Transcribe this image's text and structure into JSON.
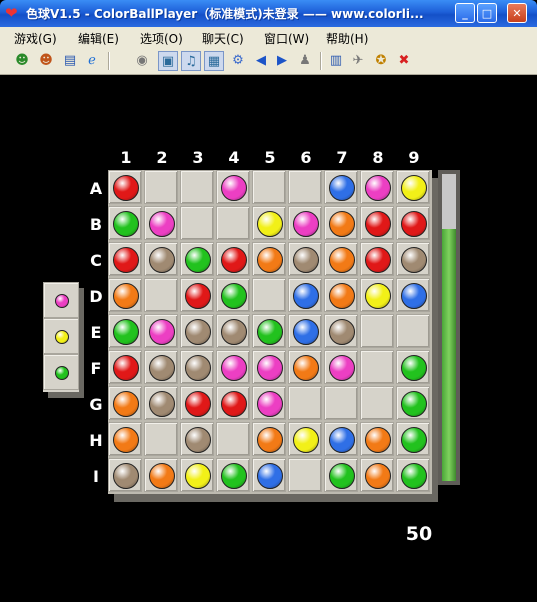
{
  "window": {
    "title": "色球V1.5 - ColorBallPlayer（标准模式)未登录 —— www.colorli...",
    "controls": [
      "_",
      "□",
      "✕"
    ]
  },
  "menu": [
    "游戏(G)",
    "编辑(E)",
    "选项(O)",
    "聊天(C)",
    "窗口(W)",
    "帮助(H)"
  ],
  "toolbar_icons": [
    "person-icon",
    "person-alt-icon",
    "window-icon",
    "ie-icon",
    "disc-icon",
    "fullscreen-icon",
    "sound-icon",
    "keyboard-icon",
    "gear-icon",
    "arrow-left-icon",
    "arrow-right-icon",
    "users-icon",
    "card-icon",
    "network-icon",
    "run-icon",
    "exit-icon"
  ],
  "board": {
    "columns": [
      "1",
      "2",
      "3",
      "4",
      "5",
      "6",
      "7",
      "8",
      "9"
    ],
    "rows": [
      "A",
      "B",
      "C",
      "D",
      "E",
      "F",
      "G",
      "H",
      "I"
    ],
    "cells": [
      [
        "red",
        "",
        "",
        "pink",
        "",
        "",
        "blue",
        "pink",
        "yellow"
      ],
      [
        "green",
        "pink",
        "",
        "",
        "yellow",
        "pink",
        "orange",
        "red",
        "red"
      ],
      [
        "red",
        "tan",
        "green",
        "red",
        "orange",
        "tan",
        "orange",
        "red",
        "tan"
      ],
      [
        "orange",
        "",
        "red",
        "green",
        "",
        "blue",
        "orange",
        "yellow",
        "blue"
      ],
      [
        "green",
        "pink",
        "tan",
        "tan",
        "green",
        "blue",
        "tan",
        "",
        ""
      ],
      [
        "red",
        "tan",
        "tan",
        "pink",
        "pink",
        "orange",
        "pink",
        "",
        "green"
      ],
      [
        "orange",
        "tan",
        "red",
        "red",
        "pink",
        "",
        "",
        "",
        "green"
      ],
      [
        "orange",
        "",
        "tan",
        "",
        "orange",
        "yellow",
        "blue",
        "orange",
        "green"
      ],
      [
        "tan",
        "orange",
        "yellow",
        "green",
        "blue",
        "",
        "green",
        "orange",
        "green"
      ]
    ]
  },
  "palette": {
    "red": "#e01818",
    "pink": "#ec3fc3",
    "blue": "#2f6fe6",
    "yellow": "#f2f018",
    "green": "#22c21e",
    "orange": "#f27a16",
    "tan": "#a08a72"
  },
  "next_balls": [
    "pink",
    "yellow",
    "green"
  ],
  "meter_level": 0.82,
  "score": "50"
}
